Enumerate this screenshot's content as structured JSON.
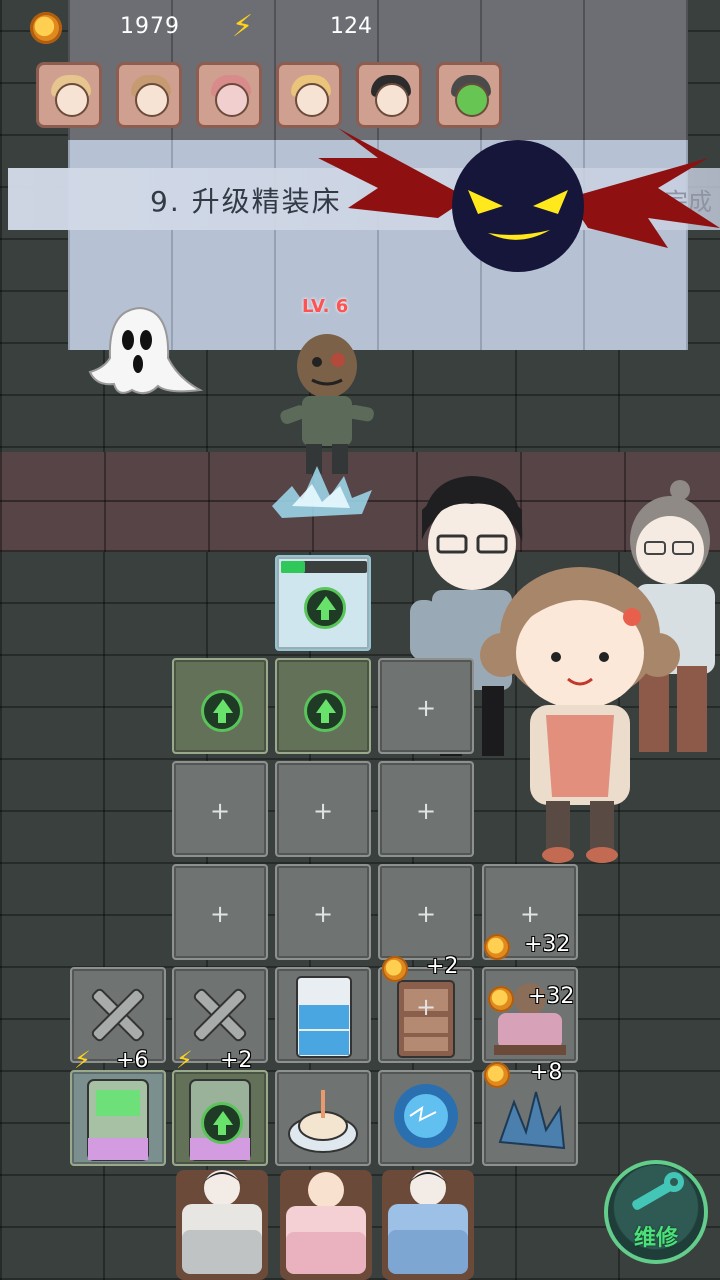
{
  "resources": {
    "coins": "1979",
    "energy": "124",
    "coin_icon": "gold-coin-icon",
    "energy_icon": "lightning-bolt-icon"
  },
  "roster": [
    {
      "name": "roster-girl-blonde",
      "hair": "#e7c58e"
    },
    {
      "name": "roster-girl-brown",
      "hair": "#c79b72"
    },
    {
      "name": "roster-girl-pink",
      "hair": "#d98a8a"
    },
    {
      "name": "roster-boy-blonde",
      "hair": "#e9c47a"
    },
    {
      "name": "roster-boy-black",
      "hair": "#2c2c2c"
    },
    {
      "name": "roster-zombie-green",
      "hair": "#4a4a4a"
    }
  ],
  "mission": {
    "title": "9. 升级精装床",
    "status": "未完成"
  },
  "enemy": {
    "level": "LV. 6"
  },
  "incomes": {
    "bed_left_top": "+2",
    "bed_right_top": "+32",
    "bed_right_mid": "+32",
    "crystal": "+8",
    "arcade_left": "+6",
    "arcade_right": "+2"
  },
  "ice_tile_progress": 0.28,
  "repair_button": {
    "label": "维修",
    "icon": "wrench-icon"
  },
  "colors": {
    "accent_green": "#4be07a",
    "coin_gold": "#ffcf52",
    "enemy_level_red": "#ff5252"
  }
}
